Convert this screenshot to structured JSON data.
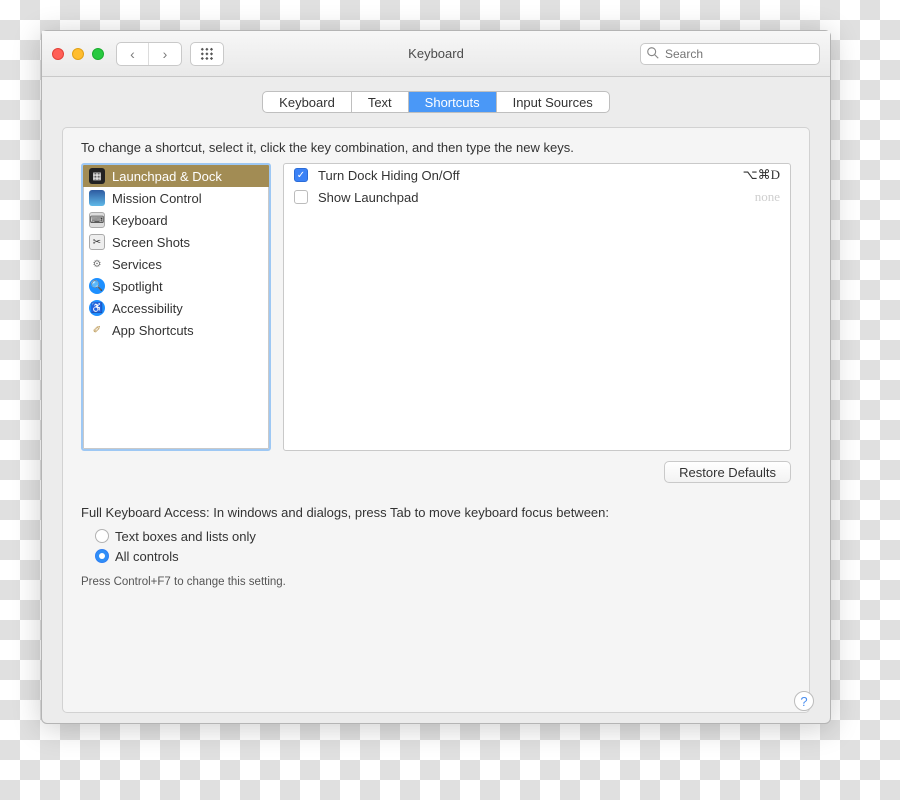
{
  "window": {
    "title": "Keyboard"
  },
  "toolbar": {
    "search_placeholder": "Search"
  },
  "tabs": [
    {
      "label": "Keyboard",
      "active": false
    },
    {
      "label": "Text",
      "active": false
    },
    {
      "label": "Shortcuts",
      "active": true
    },
    {
      "label": "Input Sources",
      "active": false
    }
  ],
  "instruction": "To change a shortcut, select it, click the key combination, and then type the new keys.",
  "categories": [
    {
      "label": "Launchpad & Dock",
      "selected": true,
      "icon": "launchpad"
    },
    {
      "label": "Mission Control",
      "selected": false,
      "icon": "mission-control"
    },
    {
      "label": "Keyboard",
      "selected": false,
      "icon": "keyboard"
    },
    {
      "label": "Screen Shots",
      "selected": false,
      "icon": "screenshot"
    },
    {
      "label": "Services",
      "selected": false,
      "icon": "services"
    },
    {
      "label": "Spotlight",
      "selected": false,
      "icon": "spotlight"
    },
    {
      "label": "Accessibility",
      "selected": false,
      "icon": "accessibility"
    },
    {
      "label": "App Shortcuts",
      "selected": false,
      "icon": "apps"
    }
  ],
  "shortcuts": [
    {
      "enabled": true,
      "name": "Turn Dock Hiding On/Off",
      "keys": "⌥⌘D"
    },
    {
      "enabled": false,
      "name": "Show Launchpad",
      "keys": "none"
    }
  ],
  "restore_label": "Restore Defaults",
  "full_keyboard_access": {
    "label": "Full Keyboard Access: In windows and dialogs, press Tab to move keyboard focus between:",
    "options": [
      {
        "label": "Text boxes and lists only",
        "selected": false
      },
      {
        "label": "All controls",
        "selected": true
      }
    ],
    "hint": "Press Control+F7 to change this setting."
  },
  "help_label": "?"
}
